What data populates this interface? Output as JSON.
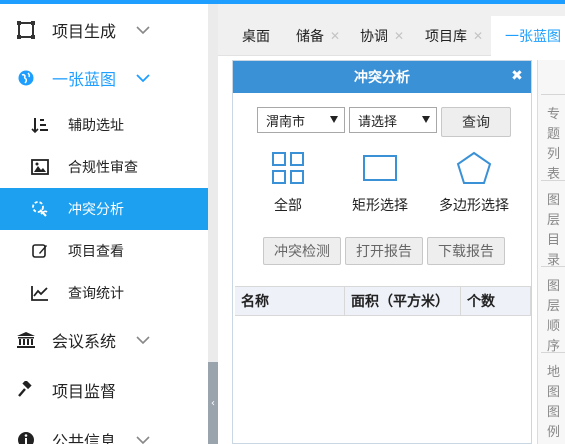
{
  "sidebar": {
    "items": [
      {
        "label": "项目生成",
        "icon": "frame-icon"
      },
      {
        "label": "一张蓝图",
        "icon": "globe-icon"
      },
      {
        "label": "会议系统",
        "icon": "bank-icon"
      },
      {
        "label": "项目监督",
        "icon": "gavel-icon"
      },
      {
        "label": "公共信息",
        "icon": "info-icon"
      }
    ],
    "subitems": [
      {
        "label": "辅助选址",
        "icon": "sort-numeric-icon"
      },
      {
        "label": "合规性审查",
        "icon": "image-icon"
      },
      {
        "label": "冲突分析",
        "icon": "conflict-icon"
      },
      {
        "label": "项目查看",
        "icon": "edit-icon"
      },
      {
        "label": "查询统计",
        "icon": "line-chart-icon"
      }
    ],
    "active_subitem": "冲突分析"
  },
  "tabs": [
    {
      "label": "桌面",
      "closable": false
    },
    {
      "label": "储备",
      "closable": true
    },
    {
      "label": "协调",
      "closable": true
    },
    {
      "label": "项目库",
      "closable": true
    },
    {
      "label": "一张蓝图",
      "closable": true
    }
  ],
  "right_panel": {
    "tabs": [
      "专题列表",
      "图层目录",
      "图层顺序",
      "地图图例"
    ]
  },
  "dialog": {
    "title": "冲突分析",
    "close_symbol": "✖",
    "city_select": "渭南市",
    "district_select": "请选择",
    "query_button": "查询",
    "shapes": [
      {
        "label": "全部",
        "icon": "grid-icon"
      },
      {
        "label": "矩形选择",
        "icon": "rectangle-icon"
      },
      {
        "label": "多边形选择",
        "icon": "polygon-icon"
      }
    ],
    "buttons": [
      "冲突检测",
      "打开报告",
      "下载报告"
    ],
    "table": {
      "columns": [
        "名称",
        "面积（平方米）",
        "个数"
      ],
      "rows": []
    }
  },
  "colors": {
    "accent": "#1e9fff",
    "active_bg": "#1ea0f0",
    "dialog_header": "#3a91d6"
  }
}
